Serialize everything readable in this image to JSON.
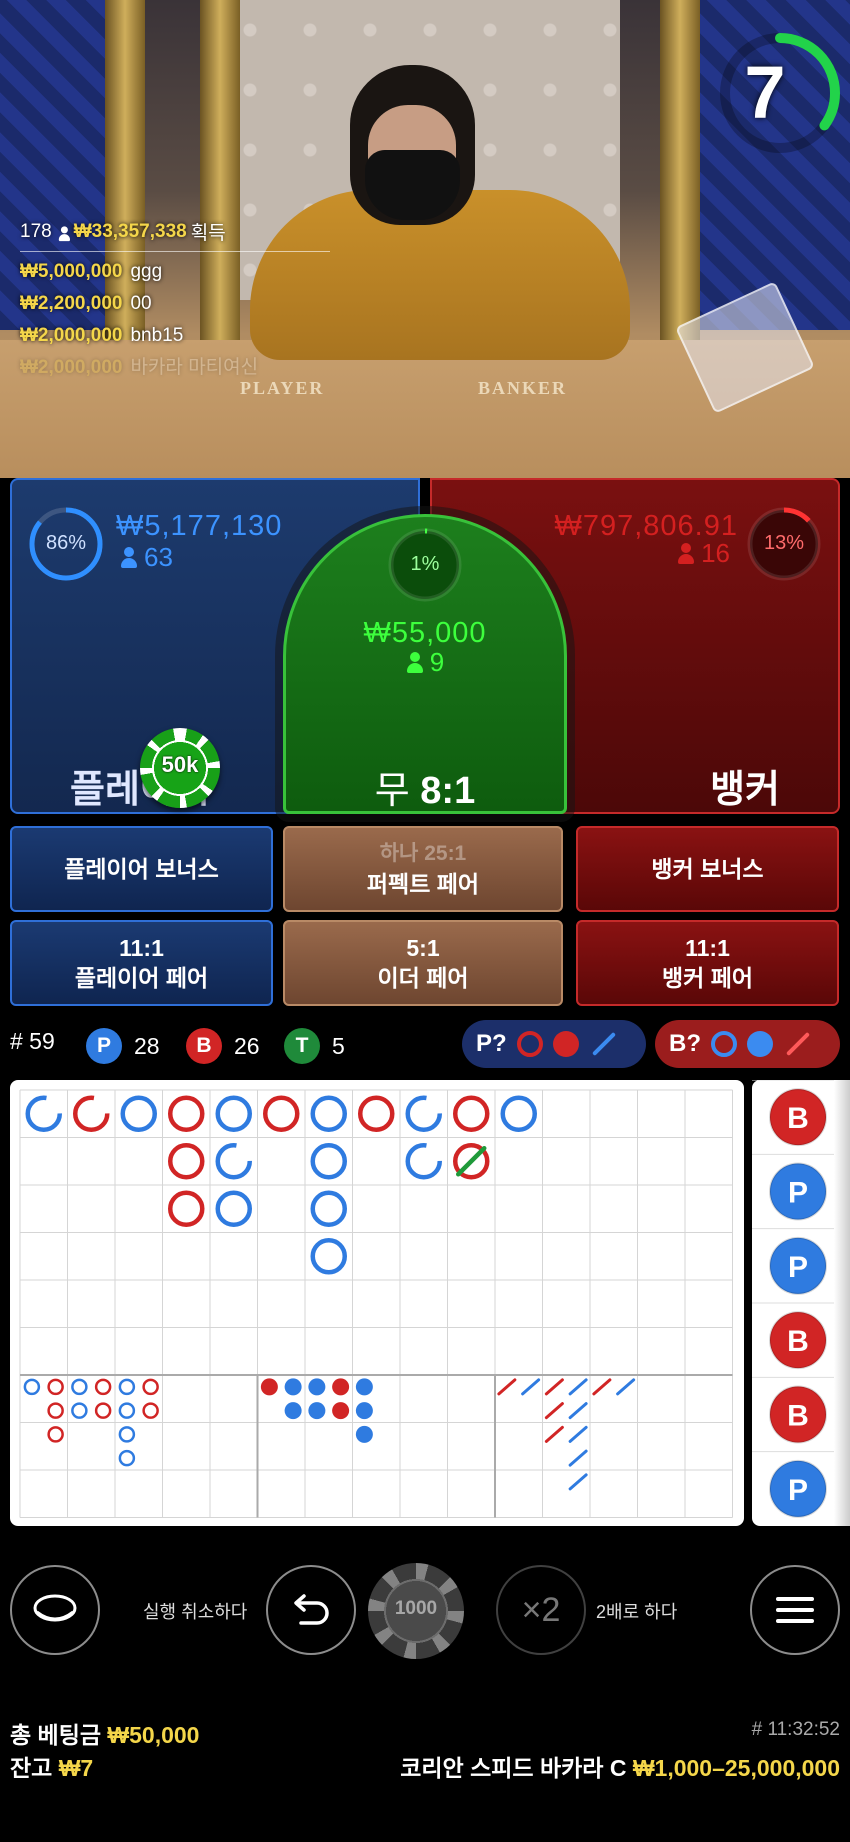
{
  "timer": {
    "seconds": "7",
    "progress": 0.35
  },
  "table_labels": {
    "player": "PLAYER",
    "banker": "BANKER"
  },
  "winners": {
    "count": "178",
    "total": "₩33,357,338",
    "suffix": "획득",
    "rows": [
      {
        "amount": "₩5,000,000",
        "name": "ggg"
      },
      {
        "amount": "₩2,200,000",
        "name": "00"
      },
      {
        "amount": "₩2,000,000",
        "name": "bnb15"
      },
      {
        "amount": "₩2,000,000",
        "name": "바카라 마티여신"
      }
    ]
  },
  "player": {
    "percent": "86%",
    "percent_value": 0.86,
    "amount": "₩5,177,130",
    "count": "63",
    "label": "플레이어",
    "chip": "50k"
  },
  "tie": {
    "percent": "1%",
    "percent_value": 0.01,
    "amount": "₩55,000",
    "count": "9",
    "label": "무",
    "odds": "8:1"
  },
  "banker": {
    "percent": "13%",
    "percent_value": 0.13,
    "amount": "₩797,806.91",
    "count": "16",
    "label": "뱅커"
  },
  "side_bets": {
    "player_bonus": "플레이어 보너스",
    "perfect_pair_top": "하나 25:1",
    "perfect_pair": "퍼펙트 페어",
    "banker_bonus": "뱅커 보너스",
    "player_pair_odds": "11:1",
    "player_pair": "플레이어 페어",
    "either_pair_odds": "5:1",
    "either_pair": "이더 페어",
    "banker_pair_odds": "11:1",
    "banker_pair": "뱅커 페어"
  },
  "stats": {
    "rounds": "# 59",
    "p_badge": "P",
    "p_count": "28",
    "b_badge": "B",
    "b_count": "26",
    "t_badge": "T",
    "t_count": "5"
  },
  "predict": {
    "player": "P?",
    "banker": "B?"
  },
  "colors": {
    "player": "#2f7be0",
    "banker": "#d12525",
    "tie": "#1f9a3a",
    "accent": "#f4d64a"
  },
  "roadmap": {
    "big_road": [
      {
        "col": 0,
        "row": 0,
        "side": "P",
        "dash": true
      },
      {
        "col": 1,
        "row": 0,
        "side": "B",
        "dash": true
      },
      {
        "col": 2,
        "row": 0,
        "side": "P"
      },
      {
        "col": 3,
        "row": 0,
        "side": "B"
      },
      {
        "col": 3,
        "row": 1,
        "side": "B"
      },
      {
        "col": 3,
        "row": 2,
        "side": "B"
      },
      {
        "col": 4,
        "row": 0,
        "side": "P"
      },
      {
        "col": 4,
        "row": 1,
        "side": "P",
        "dash": true
      },
      {
        "col": 4,
        "row": 2,
        "side": "P"
      },
      {
        "col": 5,
        "row": 0,
        "side": "B"
      },
      {
        "col": 6,
        "row": 0,
        "side": "P"
      },
      {
        "col": 6,
        "row": 1,
        "side": "P"
      },
      {
        "col": 6,
        "row": 2,
        "side": "P"
      },
      {
        "col": 6,
        "row": 3,
        "side": "P"
      },
      {
        "col": 7,
        "row": 0,
        "side": "B"
      },
      {
        "col": 8,
        "row": 0,
        "side": "P",
        "dash": true
      },
      {
        "col": 8,
        "row": 1,
        "side": "P",
        "dash": true
      },
      {
        "col": 9,
        "row": 0,
        "side": "B"
      },
      {
        "col": 9,
        "row": 1,
        "side": "B",
        "tie": true
      },
      {
        "col": 10,
        "row": 0,
        "side": "P"
      }
    ],
    "big_eye": [
      {
        "col": 0,
        "row": 0,
        "side": "P"
      },
      {
        "col": 1,
        "row": 0,
        "side": "B"
      },
      {
        "col": 1,
        "row": 1,
        "side": "B"
      },
      {
        "col": 1,
        "row": 2,
        "side": "B"
      },
      {
        "col": 2,
        "row": 0,
        "side": "P"
      },
      {
        "col": 2,
        "row": 1,
        "side": "P"
      },
      {
        "col": 3,
        "row": 0,
        "side": "B"
      },
      {
        "col": 3,
        "row": 1,
        "side": "B"
      },
      {
        "col": 4,
        "row": 0,
        "side": "P"
      },
      {
        "col": 4,
        "row": 1,
        "side": "P"
      },
      {
        "col": 4,
        "row": 2,
        "side": "P"
      },
      {
        "col": 4,
        "row": 3,
        "side": "P"
      },
      {
        "col": 5,
        "row": 0,
        "side": "B"
      },
      {
        "col": 5,
        "row": 1,
        "side": "B"
      }
    ],
    "small": [
      {
        "col": 0,
        "row": 0,
        "side": "B"
      },
      {
        "col": 1,
        "row": 0,
        "side": "P"
      },
      {
        "col": 1,
        "row": 1,
        "side": "P"
      },
      {
        "col": 2,
        "row": 0,
        "side": "P"
      },
      {
        "col": 2,
        "row": 1,
        "side": "P"
      },
      {
        "col": 3,
        "row": 0,
        "side": "B"
      },
      {
        "col": 3,
        "row": 1,
        "side": "B"
      },
      {
        "col": 4,
        "row": 0,
        "side": "P"
      },
      {
        "col": 4,
        "row": 1,
        "side": "P"
      },
      {
        "col": 4,
        "row": 2,
        "side": "P"
      }
    ],
    "cockroach": [
      {
        "col": 0,
        "row": 0,
        "side": "B"
      },
      {
        "col": 1,
        "row": 0,
        "side": "P"
      },
      {
        "col": 2,
        "row": 0,
        "side": "B"
      },
      {
        "col": 2,
        "row": 1,
        "side": "B"
      },
      {
        "col": 2,
        "row": 2,
        "side": "B"
      },
      {
        "col": 3,
        "row": 0,
        "side": "P"
      },
      {
        "col": 3,
        "row": 1,
        "side": "P"
      },
      {
        "col": 3,
        "row": 2,
        "side": "P"
      },
      {
        "col": 3,
        "row": 3,
        "side": "P"
      },
      {
        "col": 3,
        "row": 4,
        "side": "P"
      },
      {
        "col": 4,
        "row": 0,
        "side": "B"
      },
      {
        "col": 5,
        "row": 0,
        "side": "P"
      }
    ],
    "bead_road": [
      "B",
      "P",
      "P",
      "B",
      "B",
      "P"
    ]
  },
  "controls": {
    "undo_label": "실행 취소하다",
    "chip_value": "1000",
    "double_icon": "×2",
    "double_label": "2배로 하다"
  },
  "footer": {
    "total_bet_label": "총 베팅금",
    "total_bet": "₩50,000",
    "balance_label": "잔고",
    "balance": "₩7",
    "time": "# 11:32:52",
    "table_name": "코리안 스피드 바카라 C",
    "limits": "₩1,000–25,000,000"
  }
}
